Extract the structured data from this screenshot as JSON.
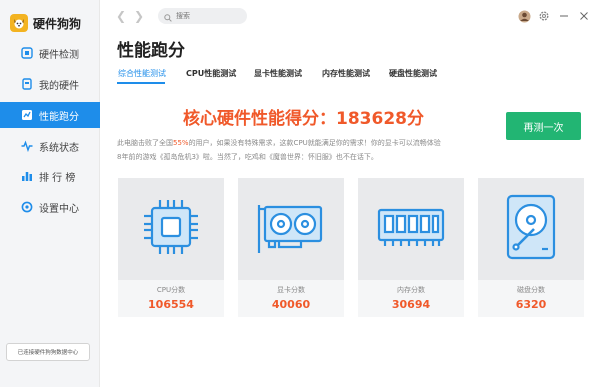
{
  "app": {
    "title": "硬件狗狗"
  },
  "sidebar": {
    "items": [
      {
        "label": "硬件检测",
        "icon": "hardware-check-icon"
      },
      {
        "label": "我的硬件",
        "icon": "my-hardware-icon"
      },
      {
        "label": "性能跑分",
        "icon": "benchmark-icon",
        "active": true
      },
      {
        "label": "系统状态",
        "icon": "system-status-icon"
      },
      {
        "label": "排 行 榜",
        "icon": "ranking-icon"
      },
      {
        "label": "设置中心",
        "icon": "settings-icon"
      }
    ],
    "footer": "已连接硬件狗狗数据中心"
  },
  "topbar": {
    "search_placeholder": "搜索"
  },
  "page": {
    "title": "性能跑分"
  },
  "tabs": [
    {
      "label": "综合性能测试",
      "active": true
    },
    {
      "label": "CPU性能测试"
    },
    {
      "label": "显卡性能测试"
    },
    {
      "label": "内存性能测试"
    },
    {
      "label": "硬盘性能测试"
    }
  ],
  "score": {
    "text": "核心硬件性能得分：183628分",
    "retest_label": "再测一次"
  },
  "description": {
    "part1": "此电脑击败了全国",
    "percent": "55%",
    "part2": "的用户，如果没有特殊需求，这款CPU就能满足你的需求！你的显卡可以流畅体验",
    "line2": "8年前的游戏《孤岛危机3》啦。当然了，吃鸡和《魔兽世界：怀旧服》也不在话下。"
  },
  "cards": [
    {
      "label": "CPU分数",
      "value": "106554",
      "icon": "cpu-icon"
    },
    {
      "label": "显卡分数",
      "value": "40060",
      "icon": "gpu-icon"
    },
    {
      "label": "内存分数",
      "value": "30694",
      "icon": "memory-icon"
    },
    {
      "label": "磁盘分数",
      "value": "6320",
      "icon": "disk-icon"
    }
  ],
  "colors": {
    "accent": "#1e8dea",
    "score": "#f0592a",
    "button": "#22b573",
    "icon_stroke": "#2b8fe0"
  }
}
